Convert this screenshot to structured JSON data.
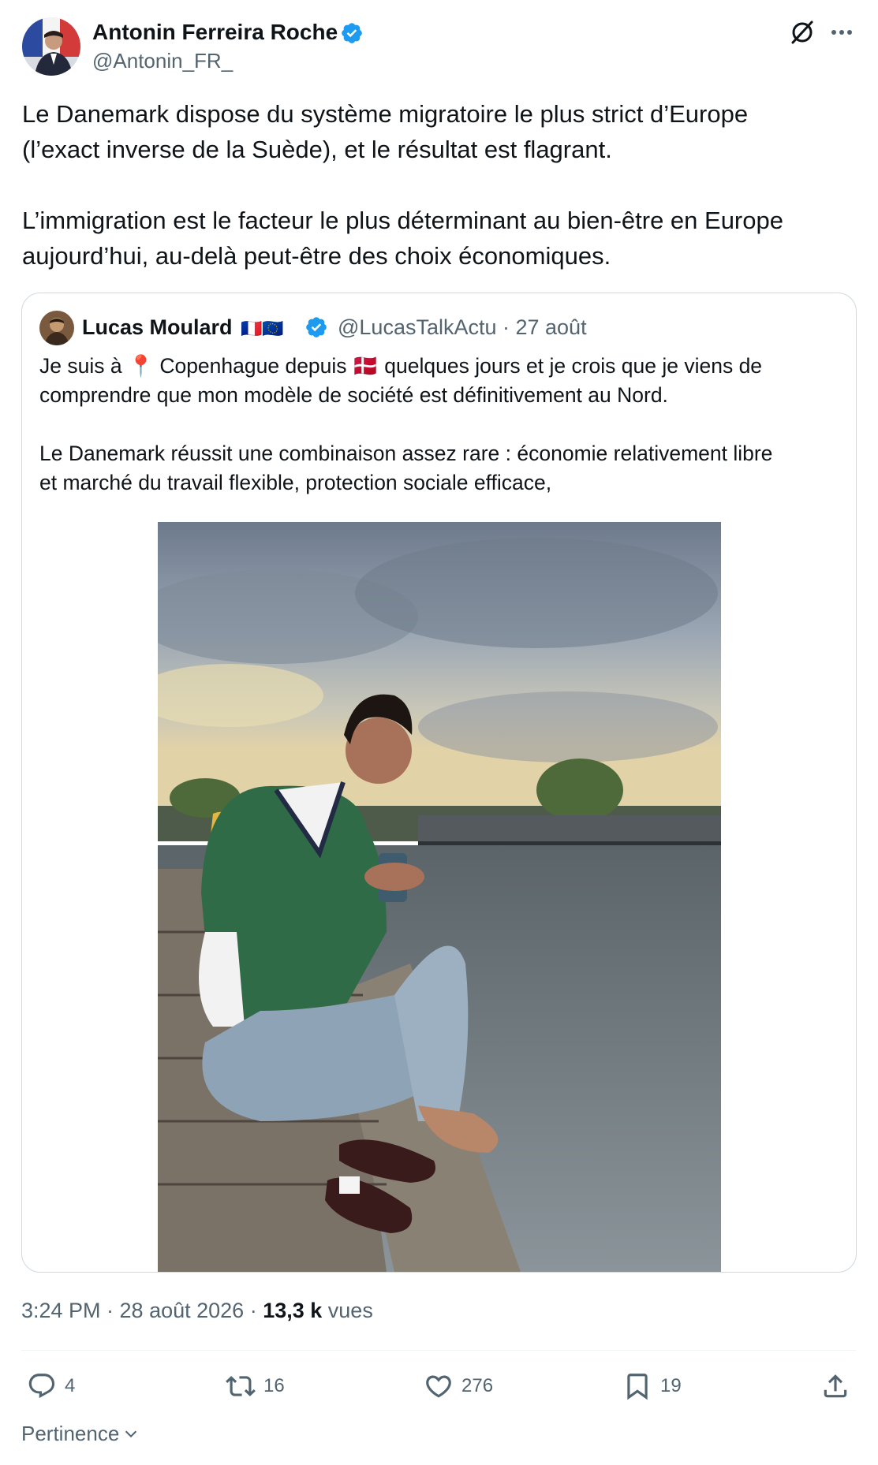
{
  "author": {
    "name": "Antonin Ferreira Roche",
    "handle": "@Antonin_FR_"
  },
  "tweet": {
    "lines": [
      "Le Danemark dispose du système migratoire le plus strict d’Europe",
      "(l’exact inverse de la Suède), et le résultat est flagrant.",
      "L’immigration est le facteur le plus déterminant au bien-être en Europe",
      "aujourd’hui, au-delà peut-être des choix économiques."
    ]
  },
  "quote": {
    "name": "Lucas Moulard",
    "flags": "🇫🇷🇪🇺",
    "handle_date": "@LucasTalkActu · 27 août",
    "line1_a": "Je suis à ",
    "pin_emoji": "📍",
    "line1_b": " Copenhague depuis ",
    "flag_emoji": "🇩🇰",
    "line1_c": " quelques jours et je crois que je viens de",
    "line2": "comprendre que mon modèle de société est définitivement au Nord.",
    "line3": "Le Danemark réussit une combinaison assez rare : économie relativement libre",
    "line4": "et marché du travail flexible, protection sociale efficace,"
  },
  "meta": {
    "time_date": "3:24 PM · 28 août 2026 · ",
    "views_count": "13,3 k",
    "views_label": " vues"
  },
  "actions": {
    "replies": "4",
    "reposts": "16",
    "likes": "276",
    "bookmarks": "19"
  },
  "sort_label": "Pertinence",
  "colors": {
    "text": "#0f1419",
    "secondary": "#536471",
    "verified": "#1d9bf0",
    "border": "#cfd9de"
  },
  "icons": [
    "verified-badge-icon",
    "grok-icon",
    "more-icon",
    "reply-icon",
    "repost-icon",
    "like-icon",
    "bookmark-icon",
    "share-icon",
    "chevron-down-icon"
  ]
}
